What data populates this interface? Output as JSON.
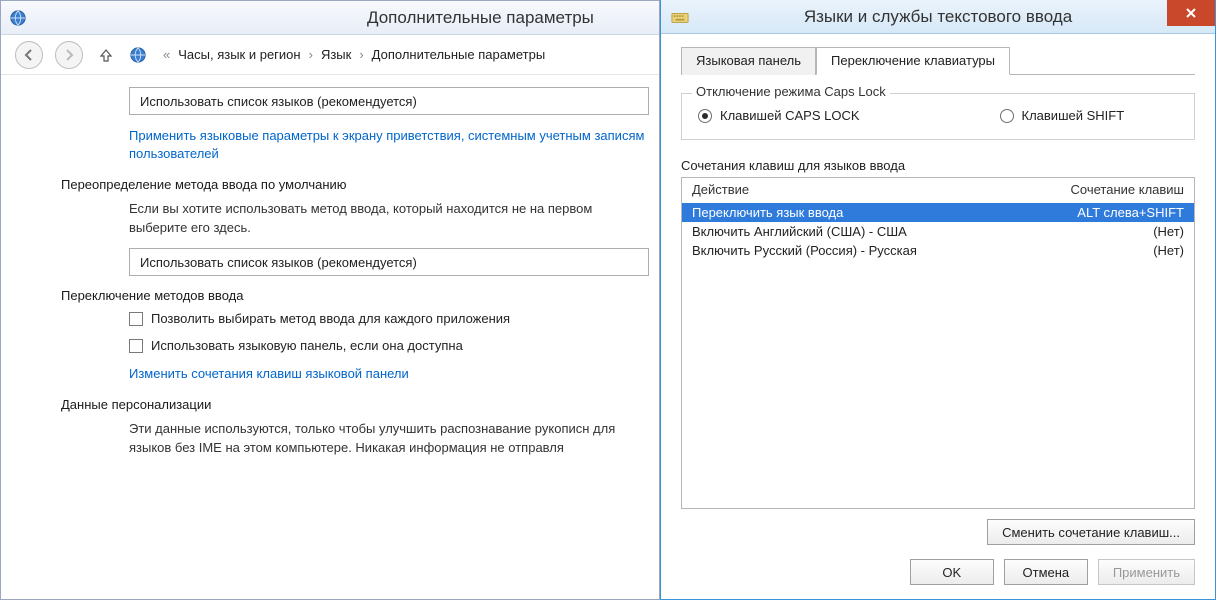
{
  "left": {
    "title": "Дополнительные параметры",
    "breadcrumb": {
      "prefix": "«",
      "items": [
        "Часы, язык и регион",
        "Язык",
        "Дополнительные параметры"
      ]
    },
    "combo1": "Использовать список языков (рекомендуется)",
    "link1": "Применить языковые параметры к экрану приветствия, системным учетным записям пользователей",
    "section_override": "Переопределение метода ввода по умолчанию",
    "override_text": "Если вы хотите использовать метод ввода, который находится не на первом выберите его здесь.",
    "combo2": "Использовать список языков (рекомендуется)",
    "section_switch": "Переключение методов ввода",
    "chk1": "Позволить выбирать метод ввода для каждого приложения",
    "chk2": "Использовать языковую панель, если она доступна",
    "link2": "Изменить сочетания клавиш языковой панели",
    "section_personal": "Данные персонализации",
    "personal_text": "Эти данные используются, только чтобы улучшить распознавание рукописн для языков без IME на этом компьютере. Никакая информация не отправля"
  },
  "right": {
    "title": "Языки и службы текстового ввода",
    "tabs": {
      "t1": "Языковая панель",
      "t2": "Переключение клавиатуры"
    },
    "caps_group_label": "Отключение режима Caps Lock",
    "radio1": "Клавишей CAPS LOCK",
    "radio2": "Клавишей SHIFT",
    "hotkey_group_label": "Сочетания клавиш для языков ввода",
    "col_action": "Действие",
    "col_hotkey": "Сочетание клавиш",
    "rows": [
      {
        "action": "Переключить язык ввода",
        "hotkey": "ALT слева+SHIFT"
      },
      {
        "action": "Включить Английский (США) - США",
        "hotkey": "(Нет)"
      },
      {
        "action": "Включить Русский (Россия) - Русская",
        "hotkey": "(Нет)"
      }
    ],
    "change_btn": "Сменить сочетание клавиш...",
    "ok": "OK",
    "cancel": "Отмена",
    "apply": "Применить"
  }
}
